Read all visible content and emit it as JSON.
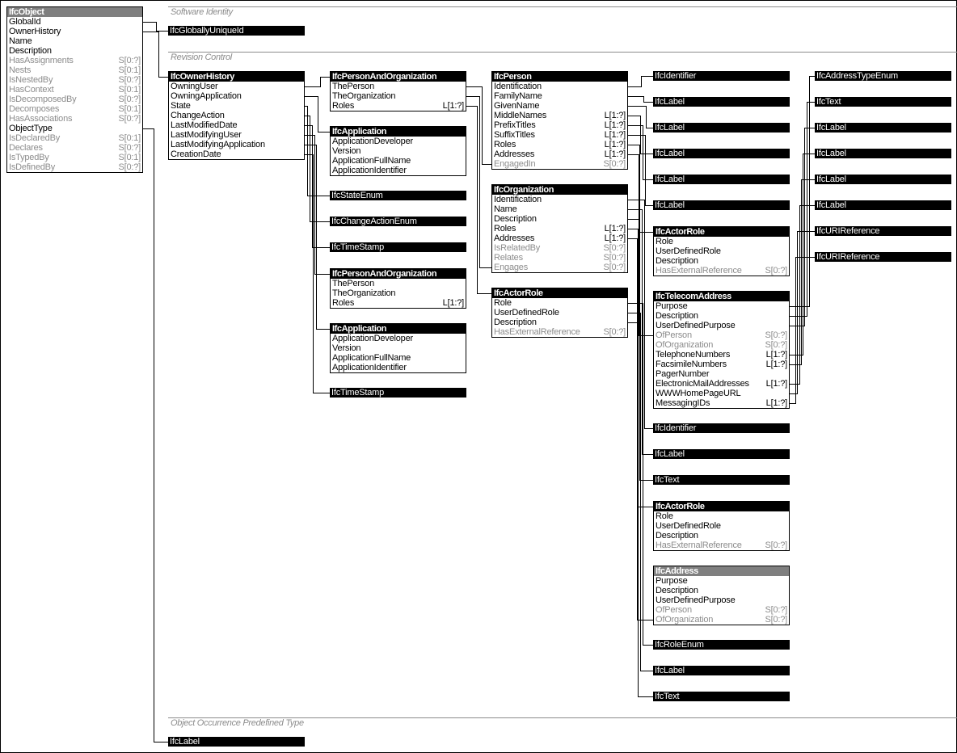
{
  "sections": [
    {
      "label": "Software Identity"
    },
    {
      "label": "Revision Control"
    },
    {
      "label": "Object Occurrence Predefined Type"
    }
  ],
  "entities": {
    "ifcObject": {
      "name": "IfcObject",
      "abstract": true,
      "rows": [
        {
          "n": "GlobalId"
        },
        {
          "n": "OwnerHistory"
        },
        {
          "n": "Name"
        },
        {
          "n": "Description"
        },
        {
          "n": "HasAssignments",
          "c": "S[0:?]",
          "inv": true
        },
        {
          "n": "Nests",
          "c": "S[0:1]",
          "inv": true
        },
        {
          "n": "IsNestedBy",
          "c": "S[0:?]",
          "inv": true
        },
        {
          "n": "HasContext",
          "c": "S[0:1]",
          "inv": true
        },
        {
          "n": "IsDecomposedBy",
          "c": "S[0:?]",
          "inv": true
        },
        {
          "n": "Decomposes",
          "c": "S[0:1]",
          "inv": true
        },
        {
          "n": "HasAssociations",
          "c": "S[0:?]",
          "inv": true
        },
        {
          "n": "ObjectType"
        },
        {
          "n": "IsDeclaredBy",
          "c": "S[0:1]",
          "inv": true
        },
        {
          "n": "Declares",
          "c": "S[0:?]",
          "inv": true
        },
        {
          "n": "IsTypedBy",
          "c": "S[0:1]",
          "inv": true
        },
        {
          "n": "IsDefinedBy",
          "c": "S[0:?]",
          "inv": true
        }
      ]
    },
    "ownerHistory": {
      "name": "IfcOwnerHistory",
      "rows": [
        {
          "n": "OwningUser"
        },
        {
          "n": "OwningApplication"
        },
        {
          "n": "State"
        },
        {
          "n": "ChangeAction"
        },
        {
          "n": "LastModifiedDate"
        },
        {
          "n": "LastModifyingUser"
        },
        {
          "n": "LastModifyingApplication"
        },
        {
          "n": "CreationDate"
        }
      ]
    },
    "personOrg1": {
      "name": "IfcPersonAndOrganization",
      "rows": [
        {
          "n": "ThePerson"
        },
        {
          "n": "TheOrganization"
        },
        {
          "n": "Roles",
          "c": "L[1:?]"
        }
      ]
    },
    "application1": {
      "name": "IfcApplication",
      "rows": [
        {
          "n": "ApplicationDeveloper"
        },
        {
          "n": "Version"
        },
        {
          "n": "ApplicationFullName"
        },
        {
          "n": "ApplicationIdentifier"
        }
      ]
    },
    "personOrg2": {
      "name": "IfcPersonAndOrganization",
      "rows": [
        {
          "n": "ThePerson"
        },
        {
          "n": "TheOrganization"
        },
        {
          "n": "Roles",
          "c": "L[1:?]"
        }
      ]
    },
    "application2": {
      "name": "IfcApplication",
      "rows": [
        {
          "n": "ApplicationDeveloper"
        },
        {
          "n": "Version"
        },
        {
          "n": "ApplicationFullName"
        },
        {
          "n": "ApplicationIdentifier"
        }
      ]
    },
    "person": {
      "name": "IfcPerson",
      "rows": [
        {
          "n": "Identification"
        },
        {
          "n": "FamilyName"
        },
        {
          "n": "GivenName"
        },
        {
          "n": "MiddleNames",
          "c": "L[1:?]"
        },
        {
          "n": "PrefixTitles",
          "c": "L[1:?]"
        },
        {
          "n": "SuffixTitles",
          "c": "L[1:?]"
        },
        {
          "n": "Roles",
          "c": "L[1:?]"
        },
        {
          "n": "Addresses",
          "c": "L[1:?]"
        },
        {
          "n": "EngagedIn",
          "c": "S[0:?]",
          "inv": true
        }
      ]
    },
    "organization": {
      "name": "IfcOrganization",
      "rows": [
        {
          "n": "Identification"
        },
        {
          "n": "Name"
        },
        {
          "n": "Description"
        },
        {
          "n": "Roles",
          "c": "L[1:?]"
        },
        {
          "n": "Addresses",
          "c": "L[1:?]"
        },
        {
          "n": "IsRelatedBy",
          "c": "S[0:?]",
          "inv": true
        },
        {
          "n": "Relates",
          "c": "S[0:?]",
          "inv": true
        },
        {
          "n": "Engages",
          "c": "S[0:?]",
          "inv": true
        }
      ]
    },
    "actorRole1": {
      "name": "IfcActorRole",
      "rows": [
        {
          "n": "Role"
        },
        {
          "n": "UserDefinedRole"
        },
        {
          "n": "Description"
        },
        {
          "n": "HasExternalReference",
          "c": "S[0:?]",
          "inv": true
        }
      ]
    },
    "actorRole2": {
      "name": "IfcActorRole",
      "rows": [
        {
          "n": "Role"
        },
        {
          "n": "UserDefinedRole"
        },
        {
          "n": "Description"
        },
        {
          "n": "HasExternalReference",
          "c": "S[0:?]",
          "inv": true
        }
      ]
    },
    "telecomAddress": {
      "name": "IfcTelecomAddress",
      "rows": [
        {
          "n": "Purpose"
        },
        {
          "n": "Description"
        },
        {
          "n": "UserDefinedPurpose"
        },
        {
          "n": "OfPerson",
          "c": "S[0:?]",
          "inv": true
        },
        {
          "n": "OfOrganization",
          "c": "S[0:?]",
          "inv": true
        },
        {
          "n": "TelephoneNumbers",
          "c": "L[1:?]"
        },
        {
          "n": "FacsimileNumbers",
          "c": "L[1:?]"
        },
        {
          "n": "PagerNumber"
        },
        {
          "n": "ElectronicMailAddresses",
          "c": "L[1:?]"
        },
        {
          "n": "WWWHomePageURL"
        },
        {
          "n": "MessagingIDs",
          "c": "L[1:?]"
        }
      ]
    },
    "actorRole3": {
      "name": "IfcActorRole",
      "rows": [
        {
          "n": "Role"
        },
        {
          "n": "UserDefinedRole"
        },
        {
          "n": "Description"
        },
        {
          "n": "HasExternalReference",
          "c": "S[0:?]",
          "inv": true
        }
      ]
    },
    "address": {
      "name": "IfcAddress",
      "abstract": true,
      "rows": [
        {
          "n": "Purpose"
        },
        {
          "n": "Description"
        },
        {
          "n": "UserDefinedPurpose"
        },
        {
          "n": "OfPerson",
          "c": "S[0:?]",
          "inv": true
        },
        {
          "n": "OfOrganization",
          "c": "S[0:?]",
          "inv": true
        }
      ]
    }
  },
  "types": {
    "globallyUniqueId": "IfcGloballyUniqueId",
    "stateEnum": "IfcStateEnum",
    "changeActionEnum": "IfcChangeActionEnum",
    "timeStamp1": "IfcTimeStamp",
    "timeStamp2": "IfcTimeStamp",
    "r_identifier1": "IfcIdentifier",
    "r_label1": "IfcLabel",
    "r_label2": "IfcLabel",
    "r_label3": "IfcLabel",
    "r_label4": "IfcLabel",
    "r_label5": "IfcLabel",
    "r_identifier2": "IfcIdentifier",
    "r_label6": "IfcLabel",
    "r_text1": "IfcText",
    "r_roleEnum": "IfcRoleEnum",
    "r_label7": "IfcLabel",
    "r_text2": "IfcText",
    "f_addressTypeEnum": "IfcAddressTypeEnum",
    "f_text": "IfcText",
    "f_label1": "IfcLabel",
    "f_label2": "IfcLabel",
    "f_label3": "IfcLabel",
    "f_label4": "IfcLabel",
    "f_uri1": "IfcURIReference",
    "f_uri2": "IfcURIReference",
    "objectTypeLabel": "IfcLabel"
  }
}
